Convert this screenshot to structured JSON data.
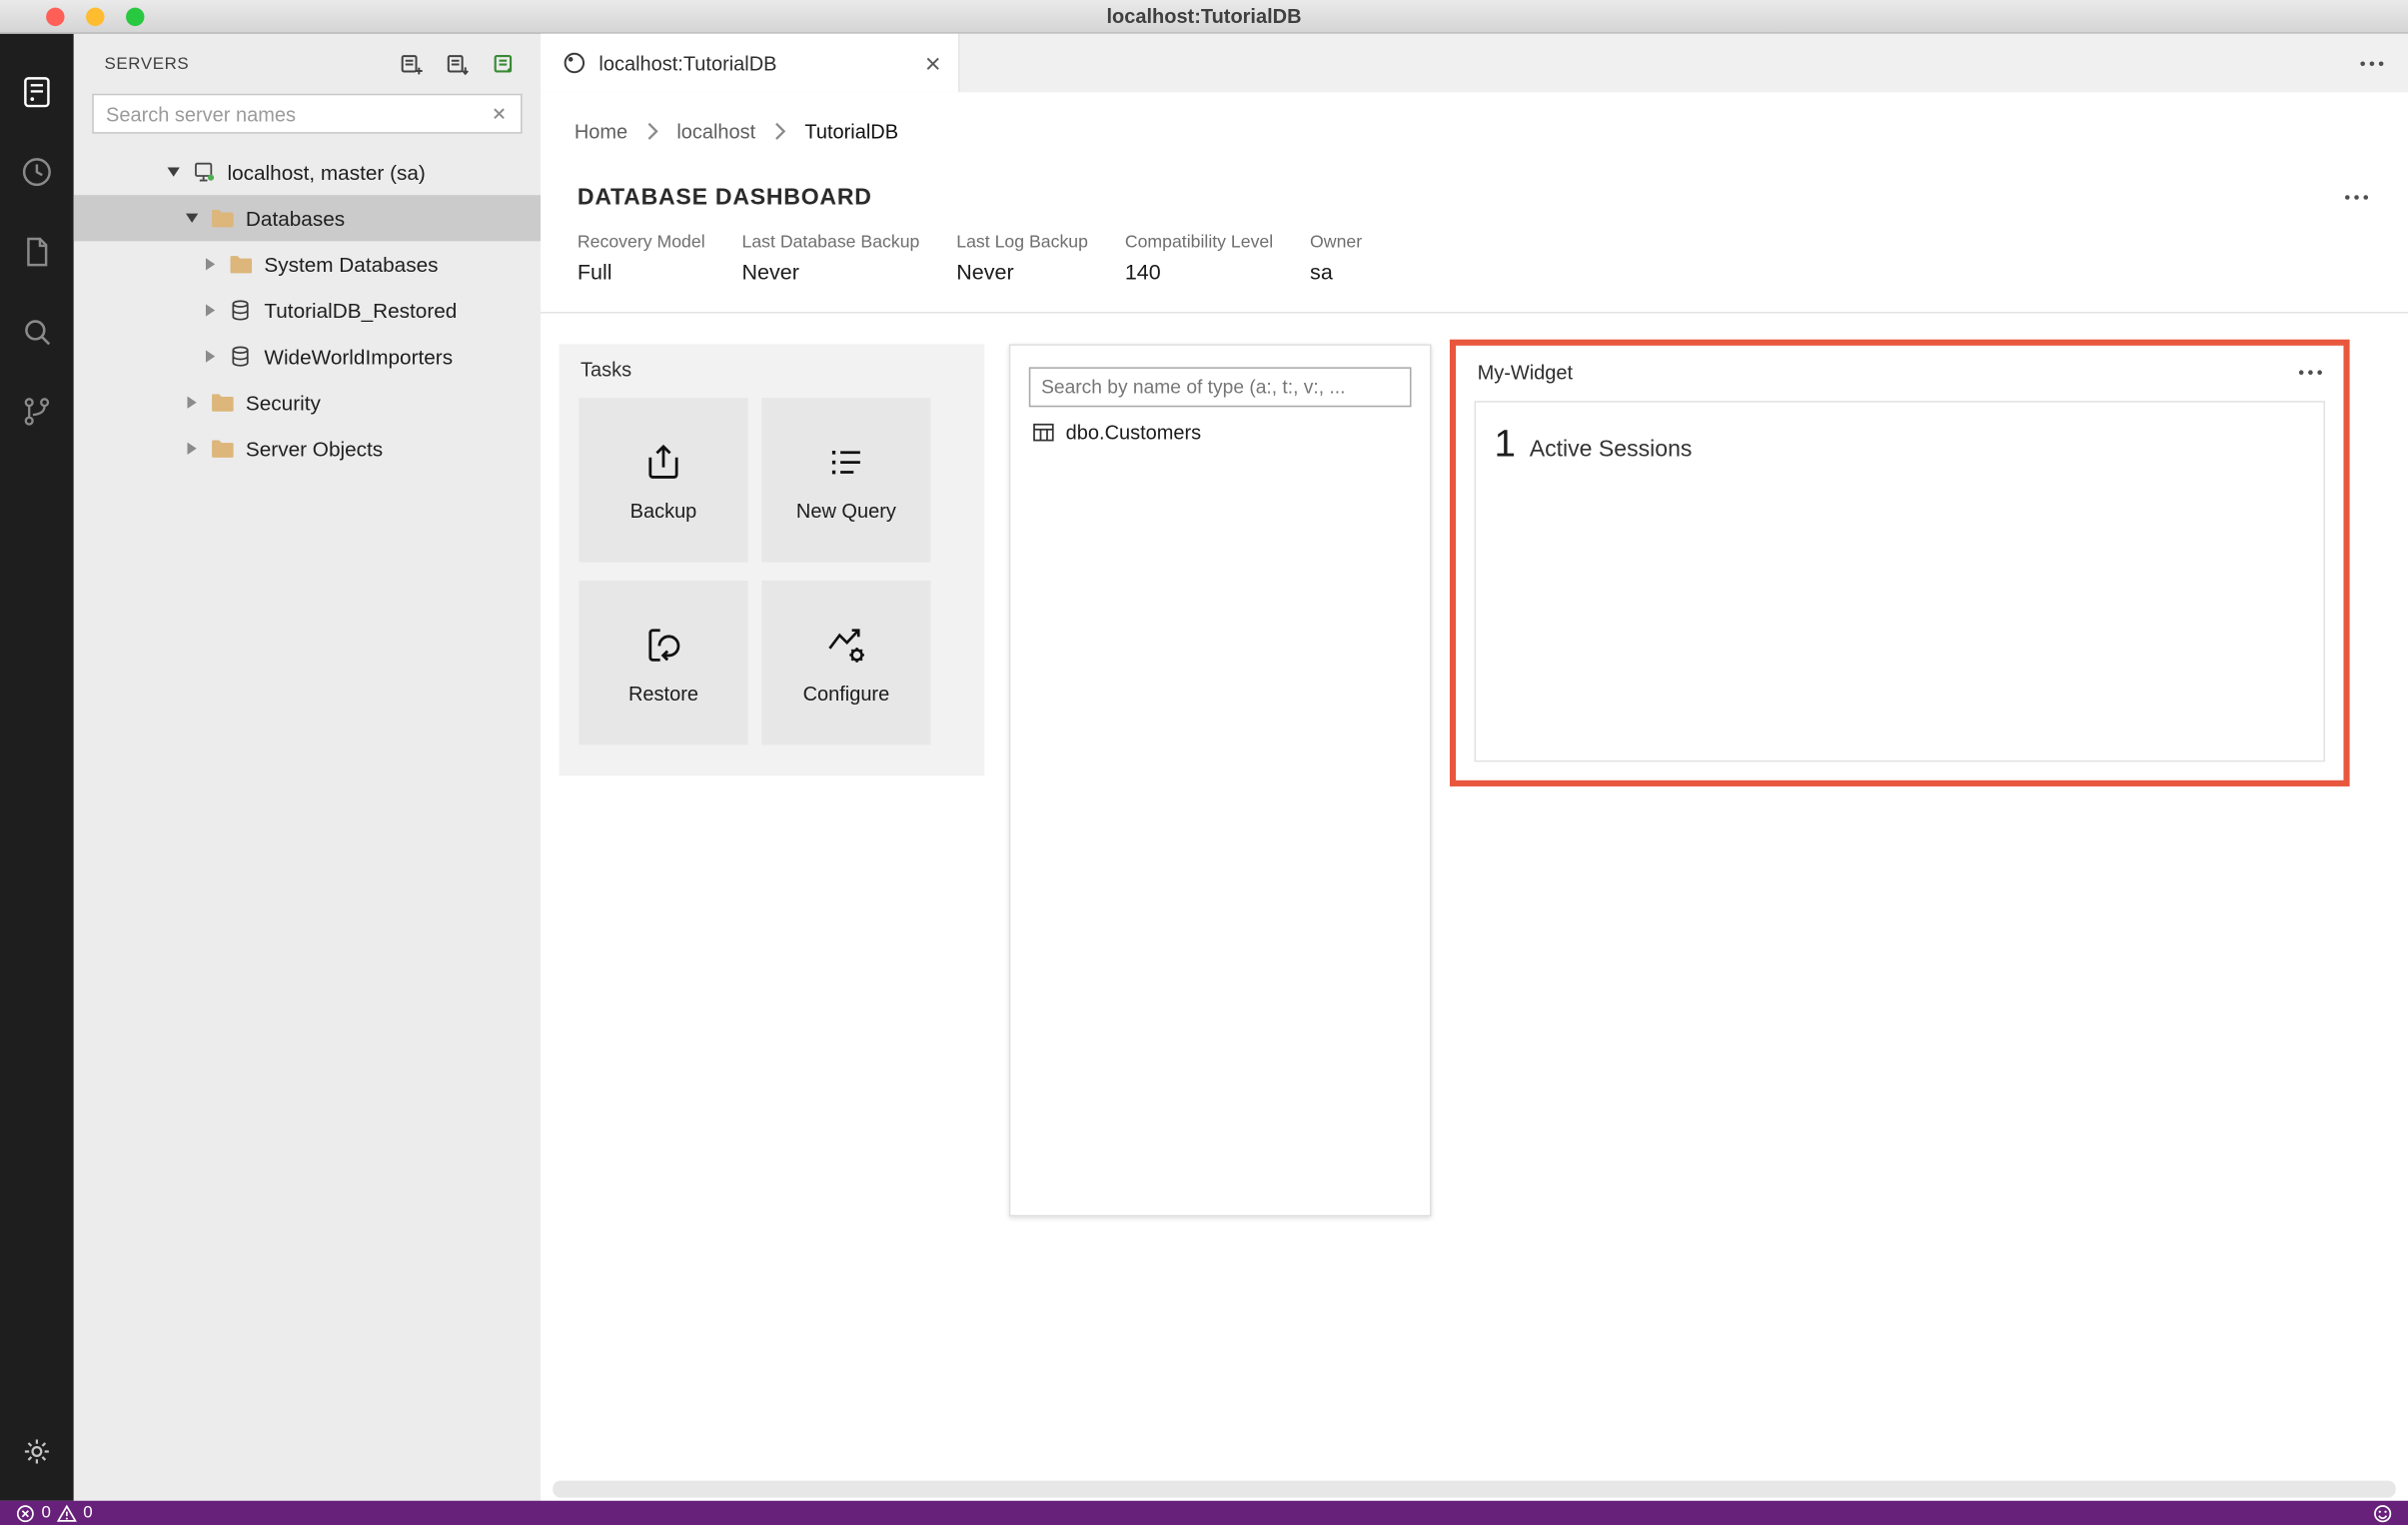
{
  "window": {
    "title": "localhost:TutorialDB"
  },
  "activity_bar": {
    "icons": [
      "connections-icon",
      "task-history-icon",
      "explorer-icon",
      "search-icon",
      "source-control-icon",
      "settings-gear-icon"
    ]
  },
  "sidebar": {
    "header": "SERVERS",
    "header_icons": [
      "new-connection-icon",
      "new-server-group-icon",
      "active-connections-icon"
    ],
    "search": {
      "placeholder": "Search server names"
    },
    "tree": [
      {
        "label": "localhost, master (sa)",
        "level": 0,
        "expanded": true,
        "icon": "server-icon"
      },
      {
        "label": "Databases",
        "level": 1,
        "expanded": true,
        "icon": "folder-icon",
        "selected": true
      },
      {
        "label": "System Databases",
        "level": 2,
        "expanded": false,
        "icon": "folder-icon"
      },
      {
        "label": "TutorialDB_Restored",
        "level": 2,
        "expanded": false,
        "icon": "database-icon"
      },
      {
        "label": "WideWorldImporters",
        "level": 2,
        "expanded": false,
        "icon": "database-icon"
      },
      {
        "label": "Security",
        "level": 1,
        "expanded": false,
        "icon": "folder-icon"
      },
      {
        "label": "Server Objects",
        "level": 1,
        "expanded": false,
        "icon": "folder-icon"
      }
    ]
  },
  "tabs": {
    "active": {
      "label": "localhost:TutorialDB",
      "icon": "dashboard-icon"
    }
  },
  "breadcrumb": {
    "items": [
      "Home",
      "localhost",
      "TutorialDB"
    ]
  },
  "dashboard": {
    "title": "DATABASE DASHBOARD",
    "properties": [
      {
        "label": "Recovery Model",
        "value": "Full"
      },
      {
        "label": "Last Database Backup",
        "value": "Never"
      },
      {
        "label": "Last Log Backup",
        "value": "Never"
      },
      {
        "label": "Compatibility Level",
        "value": "140"
      },
      {
        "label": "Owner",
        "value": "sa"
      }
    ],
    "tasks": {
      "title": "Tasks",
      "buttons": [
        {
          "label": "Backup",
          "icon": "backup-icon"
        },
        {
          "label": "New Query",
          "icon": "new-query-icon"
        },
        {
          "label": "Restore",
          "icon": "restore-icon"
        },
        {
          "label": "Configure",
          "icon": "configure-icon"
        }
      ]
    },
    "search_widget": {
      "placeholder": "Search by name of type (a:, t:, v:, ...",
      "results": [
        {
          "label": "dbo.Customers",
          "icon": "table-icon"
        }
      ]
    },
    "my_widget": {
      "title": "My-Widget",
      "count": "1",
      "label": "Active Sessions"
    }
  },
  "status_bar": {
    "errors": "0",
    "warnings": "0"
  },
  "colors": {
    "status_bar": "#68217a",
    "widget_highlight": "#e8573d",
    "folder": "#dcb67a",
    "traffic_red": "#ff5f57",
    "traffic_yellow": "#febc2e",
    "traffic_green": "#28c840"
  }
}
